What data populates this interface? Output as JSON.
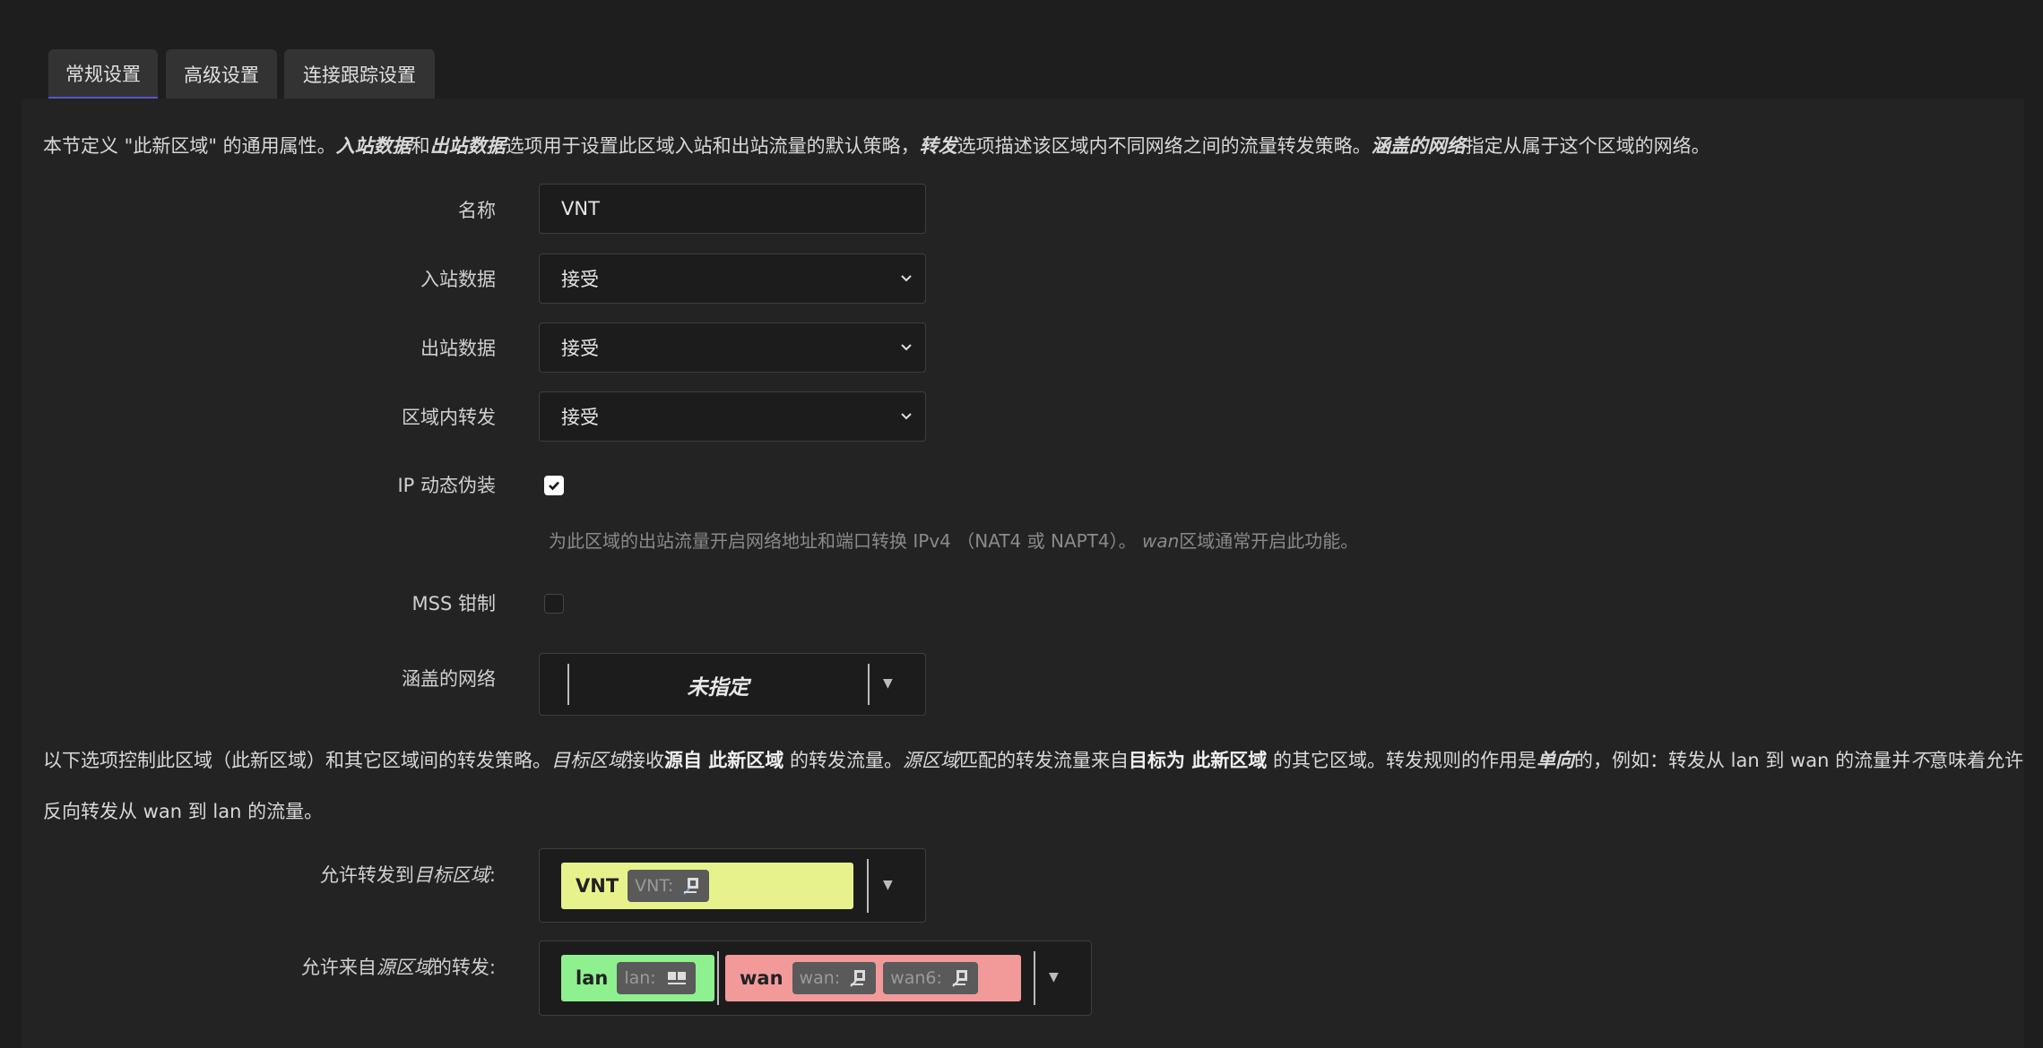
{
  "tabs": [
    {
      "label": "常规设置"
    },
    {
      "label": "高级设置"
    },
    {
      "label": "连接跟踪设置"
    }
  ],
  "intro": {
    "p1": "本节定义 \"此新区域\" 的通用属性。",
    "p2": "入站数据",
    "p3": "和",
    "p4": "出站数据",
    "p5": "选项用于设置此区域入站和出站流量的默认策略，",
    "p6": "转发",
    "p7": "选项描述该区域内不同网络之间的流量转发策略。",
    "p8": "涵盖的网络",
    "p9": "指定从属于这个区域的网络。"
  },
  "fields": {
    "name_label": "名称",
    "name_value": "VNT",
    "input_label": "入站数据",
    "input_value": "接受",
    "output_label": "出站数据",
    "output_value": "接受",
    "forward_label": "区域内转发",
    "forward_value": "接受",
    "masq_label": "IP 动态伪装",
    "masq_checked": true,
    "masq_desc_1": "为此区域的出站流量开启网络地址和端口转换 IPv4 （NAT4 或 NAPT4）。",
    "masq_desc_2": "wan",
    "masq_desc_3": "区域通常开启此功能。",
    "mss_label": "MSS 钳制",
    "mss_checked": false,
    "networks_label": "涵盖的网络",
    "networks_value": "未指定"
  },
  "forward_desc": {
    "a1": "以下选项控制此区域（此新区域）和其它区域间的转发策略。",
    "a2": "目标区域",
    "a3": "接收",
    "a4": "源自 此新区域",
    "a5": " 的转发流量。",
    "a6": "源区域",
    "a7": "匹配的转发流量来自",
    "a8": "目标为 此新区域",
    "a9": " 的其它区域。转发规则的作用是",
    "a10": "单向",
    "a11": "的，例如：转发从 lan 到 wan 的流量并",
    "a12": "不",
    "a13": "意味着允许",
    "b1": "反向转发从 wan 到 lan 的流量。"
  },
  "dest": {
    "label_1": "允许转发到",
    "label_2": "目标区域",
    "label_3": ":",
    "zones": [
      {
        "name": "VNT",
        "color": "#e8f28c",
        "chips": [
          "VNT:"
        ]
      }
    ]
  },
  "src": {
    "label_1": "允许来自",
    "label_2": "源区域",
    "label_3": "的转发:",
    "zones": [
      {
        "name": "lan",
        "color": "#8ef08e",
        "chips": [
          "lan:"
        ]
      },
      {
        "name": "wan",
        "color": "#f29a9a",
        "chips": [
          "wan:",
          "wan6:"
        ]
      }
    ]
  },
  "colors": {
    "background": "#1e1e1e",
    "panel": "#232323",
    "tab_active_underline": "#5b55c8"
  }
}
